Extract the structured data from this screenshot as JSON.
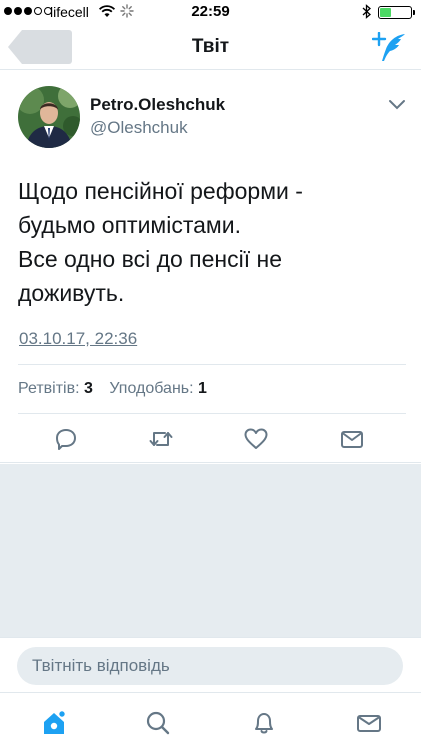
{
  "status_bar": {
    "carrier": "lifecell",
    "time": "22:59",
    "signal_filled": 3,
    "signal_total": 5,
    "battery_level": 0.35,
    "battery_color": "#4cd964"
  },
  "nav": {
    "title": "Твіт",
    "back_icon": "back-arrow-icon",
    "compose_icon": "compose-tweet-icon"
  },
  "tweet": {
    "author": {
      "name": "Petro.Oleshchuk",
      "handle": "@Oleshchuk"
    },
    "text_lines": [
      "Щодо пенсійної реформи -",
      "будьмо оптимістами.",
      "Все одно всі до пенсії не",
      "доживуть."
    ],
    "timestamp": "03.10.17, 22:36",
    "stats": {
      "retweets_label": "Ретвітів:",
      "retweets_count": "3",
      "likes_label": "Уподобань:",
      "likes_count": "1"
    },
    "actions": [
      "reply-icon",
      "retweet-icon",
      "like-icon",
      "direct-message-icon"
    ]
  },
  "reply": {
    "placeholder": "Твітніть відповідь"
  },
  "tab_bar": {
    "tabs": [
      "home-icon",
      "search-icon",
      "notifications-icon",
      "messages-icon"
    ]
  },
  "colors": {
    "accent": "#1da1f2",
    "secondary_text": "#657786",
    "icon_gray": "#657786",
    "background_gray": "#e6ecf0"
  }
}
